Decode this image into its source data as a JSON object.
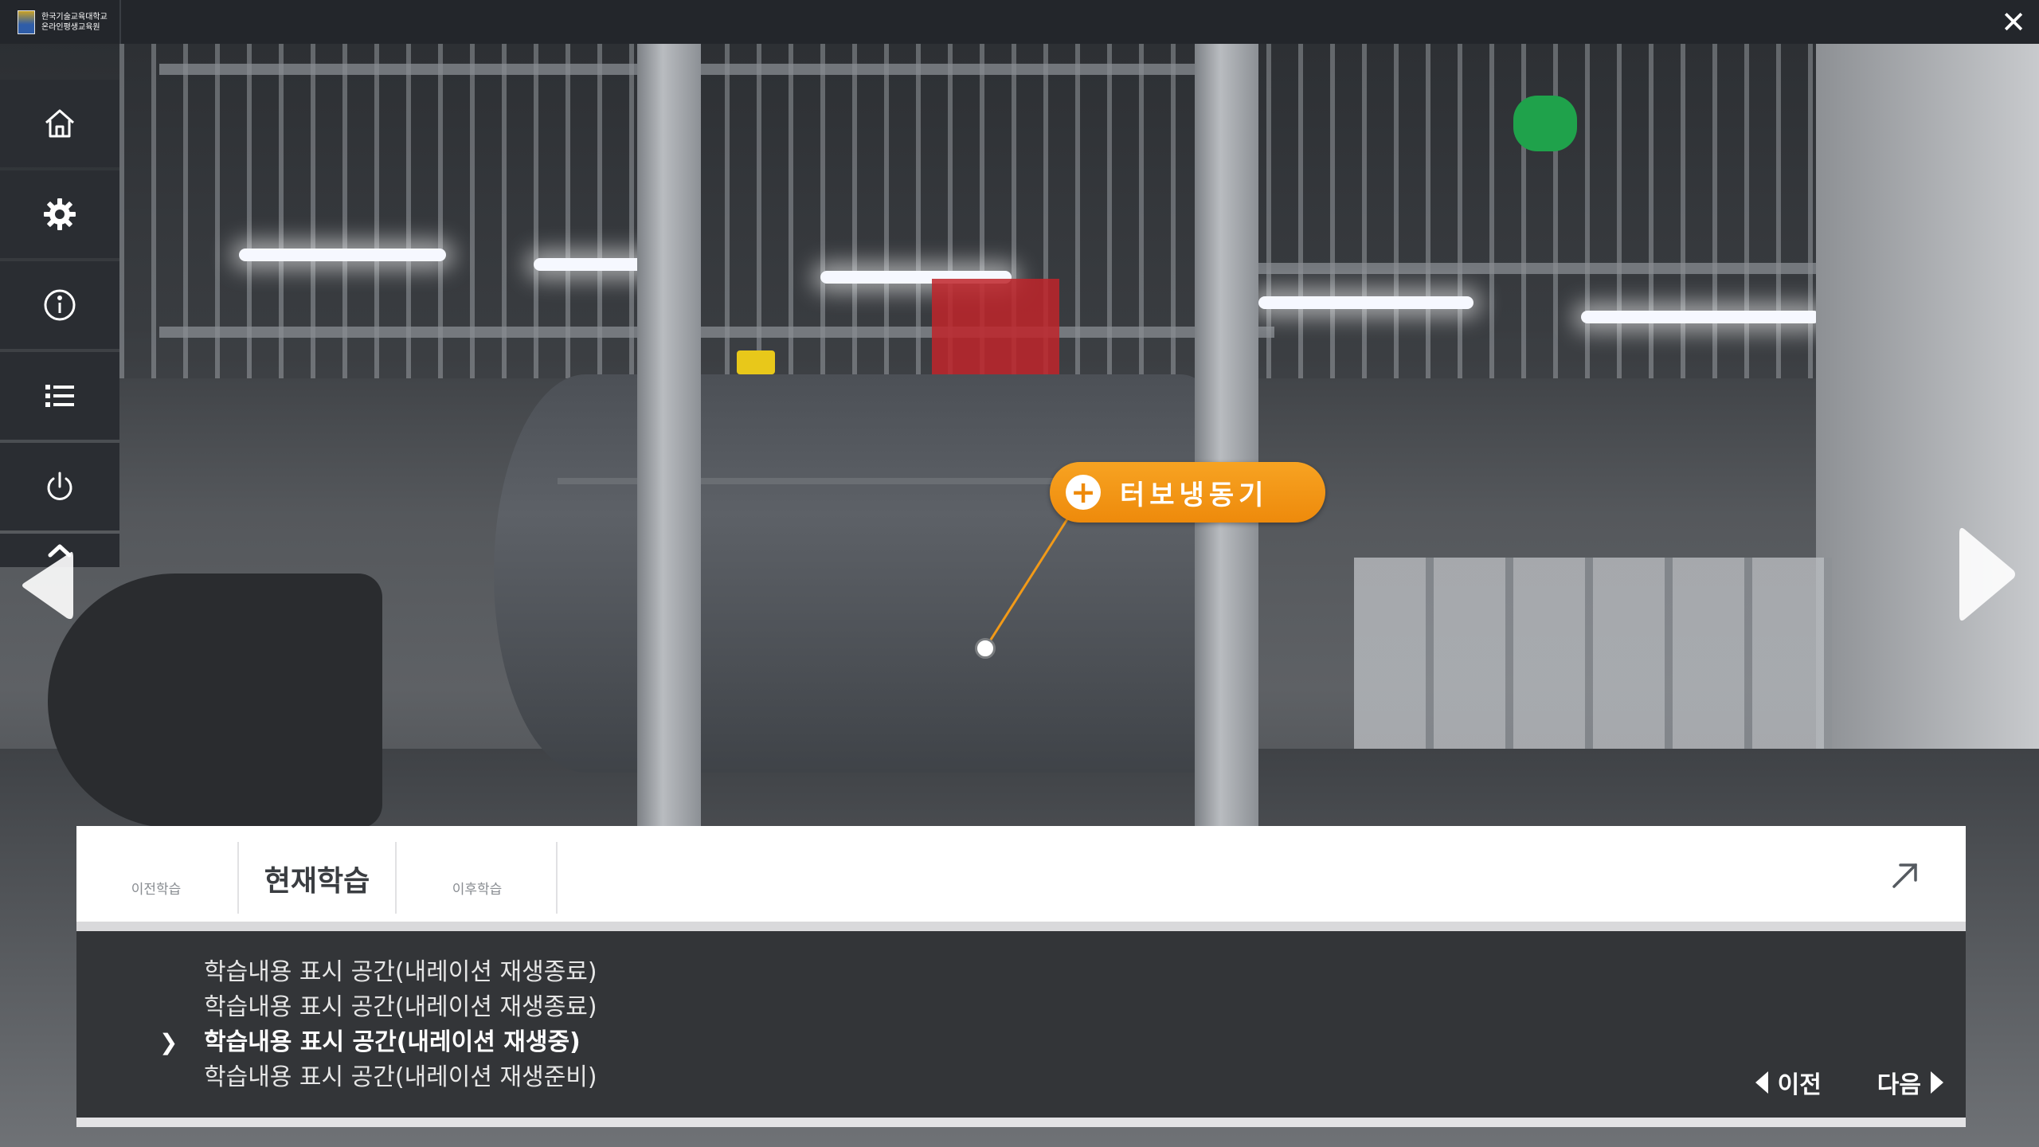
{
  "header": {
    "logo_line1": "한국기술교육대학교",
    "logo_line2": "온라인평생교육원",
    "close_label": "✕"
  },
  "sidebar": {
    "items": [
      {
        "name": "home",
        "icon": "home-icon"
      },
      {
        "name": "settings",
        "icon": "gear-icon"
      },
      {
        "name": "info",
        "icon": "info-icon"
      },
      {
        "name": "list",
        "icon": "list-icon"
      },
      {
        "name": "power",
        "icon": "power-icon"
      }
    ],
    "toggle_icon": "chevron-up-icon"
  },
  "hotspot": {
    "label": "터보냉동기",
    "plus": "+"
  },
  "panel": {
    "tabs": {
      "prev": "이전학습",
      "current": "현재학습",
      "next": "이후학습"
    },
    "lines": [
      {
        "text": "학습내용 표시 공간(내레이션 재생종료)",
        "active": false
      },
      {
        "text": "학습내용 표시 공간(내레이션 재생종료)",
        "active": false
      },
      {
        "text": "학습내용 표시 공간(내레이션 재생중)",
        "active": true
      },
      {
        "text": "학습내용 표시 공간(내레이션 재생준비)",
        "active": false
      }
    ],
    "active_marker": "❯",
    "prev_button": "이전",
    "next_button": "다음"
  },
  "colors": {
    "accent": "#ee8a0b",
    "topbar": "#23262b",
    "sidebar": "#2a2d32",
    "panel_body": "#333538"
  }
}
